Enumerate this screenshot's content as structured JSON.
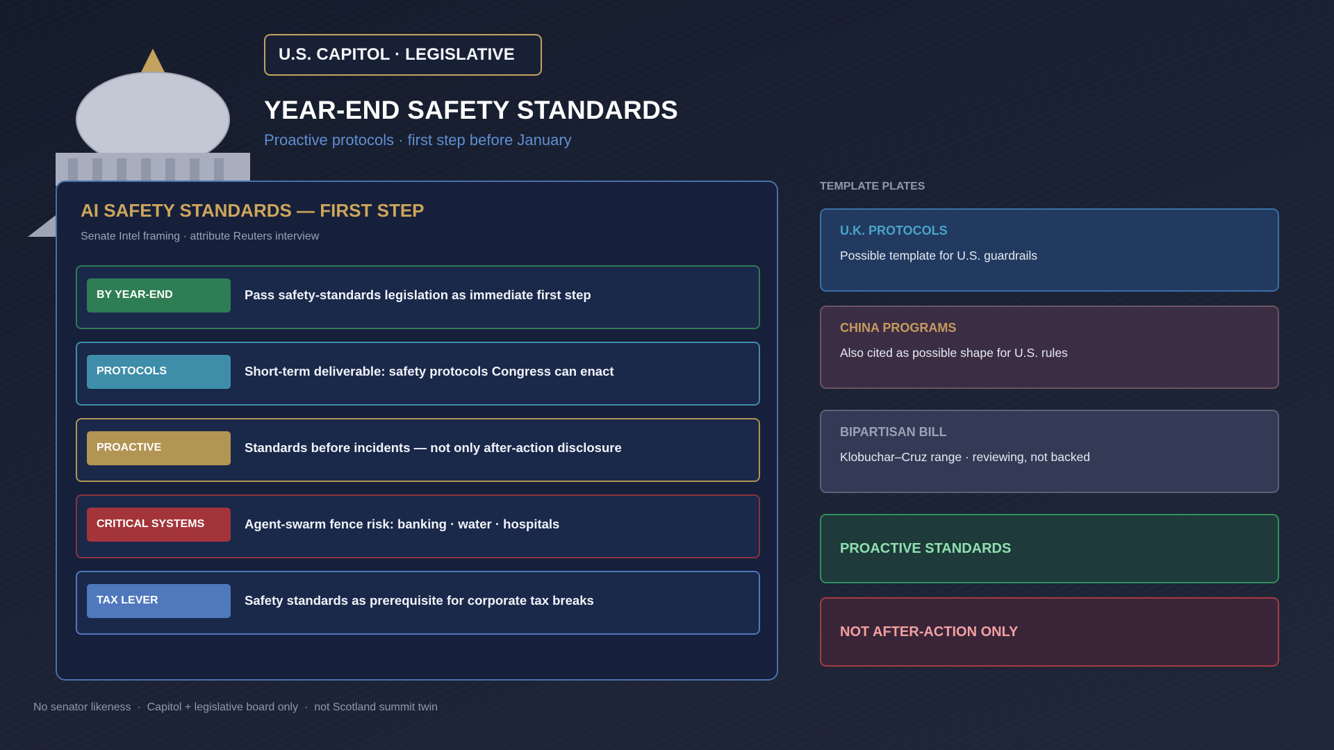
{
  "header": {
    "badge": "U.S. CAPITOL · LEGISLATIVE",
    "title": "YEAR-END SAFETY STANDARDS",
    "subtitle": "Proactive protocols · first step before January"
  },
  "board": {
    "title": "AI SAFETY STANDARDS — FIRST STEP",
    "subtitle": "Senate Intel framing · attribute Reuters interview",
    "rows": [
      {
        "tag": "BY YEAR-END",
        "text": "Pass safety-standards legislation as immediate first step",
        "tag_color": "#2f7d55",
        "border_color": "#2f7d55"
      },
      {
        "tag": "PROTOCOLS",
        "text": "Short-term deliverable: safety protocols Congress can enact",
        "tag_color": "#3f8ea9",
        "border_color": "#3f8ea9"
      },
      {
        "tag": "PROACTIVE",
        "text": "Standards before incidents — not only after-action disclosure",
        "tag_color": "#b39553",
        "border_color": "#b39553"
      },
      {
        "tag": "CRITICAL SYSTEMS",
        "text": "Agent-swarm fence risk: banking · water · hospitals",
        "tag_color": "#a3353a",
        "border_color": "#8a3240"
      },
      {
        "tag": "TAX LEVER",
        "text": "Safety standards as prerequisite for corporate tax breaks",
        "tag_color": "#4f78bd",
        "border_color": "#4f78bd"
      }
    ]
  },
  "plates": {
    "heading": "TEMPLATE PLATES",
    "items": [
      {
        "title": "U.K. PROTOCOLS",
        "text": "Possible template for U.S. guardrails",
        "title_color": "#4aa3c8",
        "bg": "#223a60",
        "border": "#3a6fa8"
      },
      {
        "title": "CHINA PROGRAMS",
        "text": "Also cited as possible shape for U.S. rules",
        "title_color": "#c59a5e",
        "bg": "#3b2e44",
        "border": "#6b5560"
      },
      {
        "title": "BIPARTISAN BILL",
        "text": "Klobuchar–Cruz range · reviewing, not backed",
        "title_color": "#9aa2b5",
        "bg": "#333a55",
        "border": "#5a6178"
      },
      {
        "title": "PROACTIVE STANDARDS",
        "title_color": "#8fe0b0",
        "bg": "#1f3a3a",
        "border": "#2f8f5c"
      },
      {
        "title": "NOT AFTER-ACTION ONLY",
        "title_color": "#f2a0a0",
        "bg": "#3a2538",
        "border": "#a83a44"
      }
    ]
  },
  "footer": "No senator likeness  ·  Capitol + legislative board only  ·  not Scotland summit twin"
}
